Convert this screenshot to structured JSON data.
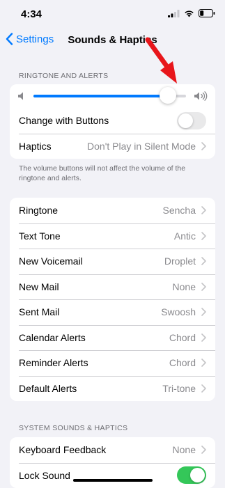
{
  "status": {
    "time": "4:34"
  },
  "nav": {
    "back_label": "Settings",
    "title": "Sounds & Haptics"
  },
  "ringtone_section": {
    "header": "RINGTONE AND ALERTS",
    "volume_level": 0.88,
    "change_with_buttons": {
      "label": "Change with Buttons",
      "on": false
    },
    "haptics": {
      "label": "Haptics",
      "value": "Don't Play in Silent Mode"
    },
    "footer": "The volume buttons will not affect the volume of the ringtone and alerts."
  },
  "sounds_list": [
    {
      "label": "Ringtone",
      "value": "Sencha"
    },
    {
      "label": "Text Tone",
      "value": "Antic"
    },
    {
      "label": "New Voicemail",
      "value": "Droplet"
    },
    {
      "label": "New Mail",
      "value": "None"
    },
    {
      "label": "Sent Mail",
      "value": "Swoosh"
    },
    {
      "label": "Calendar Alerts",
      "value": "Chord"
    },
    {
      "label": "Reminder Alerts",
      "value": "Chord"
    },
    {
      "label": "Default Alerts",
      "value": "Tri-tone"
    }
  ],
  "system_section": {
    "header": "SYSTEM SOUNDS & HAPTICS",
    "keyboard_feedback": {
      "label": "Keyboard Feedback",
      "value": "None"
    },
    "lock_sound": {
      "label": "Lock Sound",
      "on": true
    }
  },
  "colors": {
    "accent": "#007aff",
    "toggle_on": "#34c759",
    "toggle_off": "#e9e9ea",
    "annotation": "#e8161b"
  }
}
